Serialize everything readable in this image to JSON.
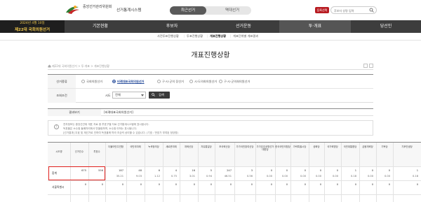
{
  "header": {
    "org_name": "중앙선거관리위원회",
    "system_name": "선거통계시스템",
    "tabs": [
      "최근선거",
      "역대선거"
    ],
    "select_button": "등록선택",
    "search_placeholder": "후보자 성명 입력",
    "banner_date": "2024년 4월 10일",
    "banner_title": "제22대 국회의원선거"
  },
  "nav": {
    "items": [
      "기본현황",
      "후보자",
      "선거운동",
      "투·개표",
      "당선인"
    ],
    "active_index": 3
  },
  "subnav": {
    "items": [
      "사전투표진행상황",
      "투표진행상황",
      "개표진행상황",
      "개표단위별 개표결과"
    ],
    "active_index": 2
  },
  "page": {
    "title": "개표진행상황",
    "breadcrumb": "제22대 국회의원선거 > 투·개표 > 개표진행상황"
  },
  "form": {
    "election_type_label": "선거종류",
    "election_types": [
      "국회의원선거",
      "비례대표국회의원선거",
      "구·시·군의 장선거",
      "시·도의회의원선거",
      "구·시·군의회의원선거"
    ],
    "selected_type_index": 1,
    "condition_label": "조회조건",
    "city_label": "시도",
    "city_value": "전체",
    "search_button": "검색"
  },
  "result": {
    "label": "결과보기",
    "value": "[비례대표국회의원선거]"
  },
  "notice": {
    "lines": [
      "전자정보는 중앙선관위 개표 자료 중 투표구별 자료 선거통계시스템에 표시됩니다.",
      "득표율은 소수점 둘째자리에서 반올림하며, 소수점 이하는 표시됩니다.",
      "[선거결과] 무효 및 재선거로 인하여 득표율에 따라 조금씩 상이할 수 있습니다. (기호 : 번호가 부여된 정당명)"
    ]
  },
  "table": {
    "headers": [
      "시도명",
      "선거인수",
      "투표수",
      "더불어민주연합",
      "국민의미래",
      "녹색정의당",
      "새로운미래",
      "개혁신당",
      "자유통일당",
      "조국혁신당",
      "가가국민참여신당",
      "가가호호공명선거대한당",
      "한국국민의힘당",
      "가락특별시당",
      "공화당",
      "국가혁명당",
      "국민대통합당",
      "금융개혁당",
      "기독당",
      "기후민생당"
    ],
    "rows": [
      {
        "name": "합계",
        "electors": "675",
        "voters": "556",
        "votes": [
          "187",
          "48",
          "6",
          "4",
          "16",
          "5",
          "247",
          "3",
          "0",
          "0",
          "0",
          "0",
          "0",
          "1",
          "0",
          "0",
          "1"
        ],
        "pct": [
          "35.21",
          "9.03",
          "1.12",
          "0.75",
          "3.01",
          "0.94",
          "46.51",
          "0.56",
          "0.00",
          "0.00",
          "0.00",
          "0.00",
          "0.00",
          "0.18",
          "0.00",
          "0.00",
          "0.18"
        ]
      },
      {
        "name": "서울특별시",
        "electors": "0",
        "voters": "0",
        "votes": [
          "0",
          "0",
          "0",
          "0",
          "0",
          "0",
          "0",
          "0",
          "0",
          "0",
          "0",
          "0",
          "0",
          "0",
          "0",
          "0",
          "0"
        ]
      }
    ]
  },
  "colors": {
    "nav_bg": "#3d3d3d",
    "banner_text": "#f2c94c",
    "accent_red": "#b81c22",
    "highlight_border": "#e0201d",
    "link_blue": "#2a4f9c"
  }
}
